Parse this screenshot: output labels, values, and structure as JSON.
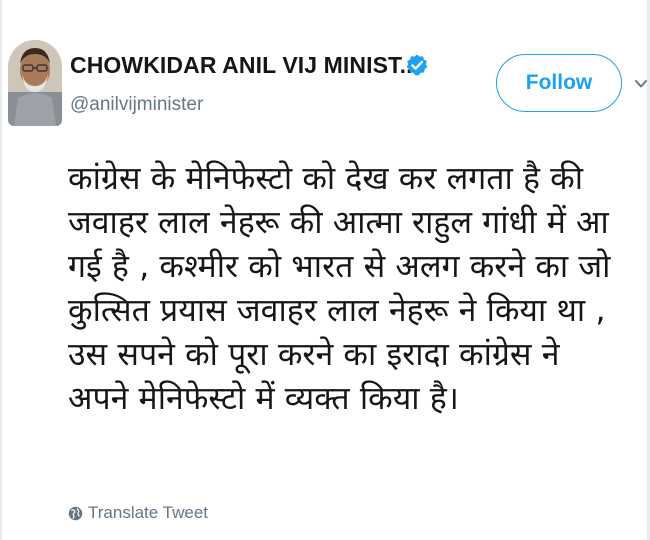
{
  "author": {
    "display_name": "CHOWKIDAR ANIL VIJ MINIST...",
    "handle": "@anilvijminister",
    "verified": true
  },
  "follow_button": {
    "label": "Follow"
  },
  "tweet": {
    "lines": [
      "कांग्रेस के मेनिफेस्टो को देख कर लगता है की",
      "जवाहर लाल नेहरू की आत्मा राहुल गांधी में आ",
      "गई है , कश्मीर को भारत से अलग करने का जो",
      "कुत्सित प्रयास  जवाहर लाल नेहरू ने किया था ,",
      "उस सपने को पूरा करने का इरादा कांग्रेस ने",
      "अपने मेनिफेस्टो में व्यक्त किया है।"
    ]
  },
  "translate": {
    "label": "Translate Tweet",
    "icon": "globe-icon"
  },
  "colors": {
    "accent": "#1da1f2",
    "text_primary": "#14171a",
    "text_secondary": "#657786",
    "border": "#e6ecf0"
  }
}
